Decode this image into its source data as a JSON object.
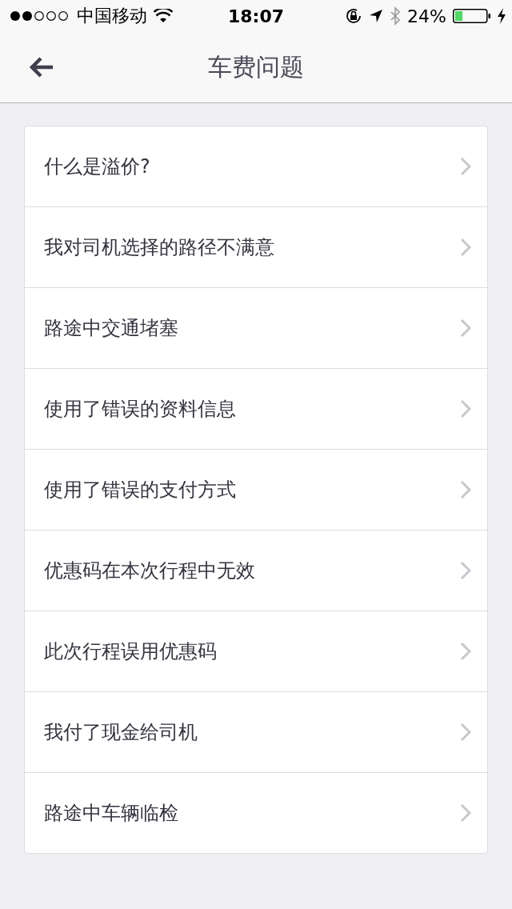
{
  "status_bar": {
    "carrier": "中国移动",
    "time": "18:07",
    "battery": "24%"
  },
  "nav": {
    "title": "车费问题"
  },
  "items": [
    {
      "label": "什么是溢价?"
    },
    {
      "label": "我对司机选择的路径不满意"
    },
    {
      "label": "路途中交通堵塞"
    },
    {
      "label": "使用了错误的资料信息"
    },
    {
      "label": "使用了错误的支付方式"
    },
    {
      "label": "优惠码在本次行程中无效"
    },
    {
      "label": "此次行程误用优惠码"
    },
    {
      "label": "我付了现金给司机"
    },
    {
      "label": "路途中车辆临检"
    }
  ]
}
